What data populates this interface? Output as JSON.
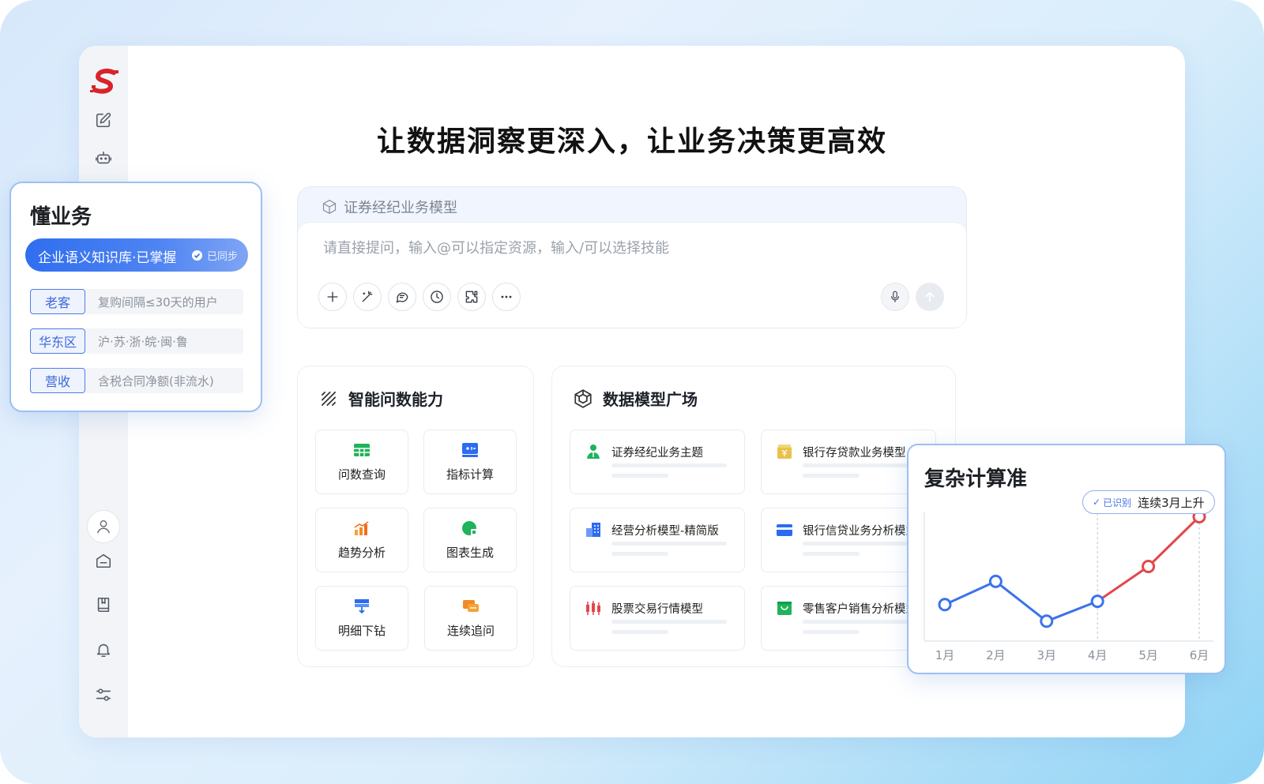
{
  "headline": "让数据洞察更深入，让业务决策更高效",
  "colors": {
    "accent": "#2f6ef0",
    "rising": "#e2474b",
    "line": "#3b73ec"
  },
  "sidebar": {
    "icons": [
      "logo-icon",
      "edit-icon",
      "robot-icon",
      "user-icon",
      "home-icon",
      "book-icon",
      "bell-icon",
      "settings-sliders-icon"
    ]
  },
  "input": {
    "model_label": "证券经纪业务模型",
    "placeholder": "请直接提问，输入@可以指定资源，输入/可以选择技能",
    "tools": [
      "plus-icon",
      "magic-wand-icon",
      "chat-icon",
      "clock-icon",
      "puzzle-icon",
      "more-icon"
    ]
  },
  "capabilities": {
    "title": "智能问数能力",
    "items": [
      {
        "label": "问数查询",
        "icon": "table-icon"
      },
      {
        "label": "指标计算",
        "icon": "calculator-icon"
      },
      {
        "label": "趋势分析",
        "icon": "bar-trend-icon"
      },
      {
        "label": "图表生成",
        "icon": "pie-icon"
      },
      {
        "label": "明细下钻",
        "icon": "drilldown-icon"
      },
      {
        "label": "连续追问",
        "icon": "followup-icon"
      }
    ]
  },
  "plaza": {
    "title": "数据模型广场",
    "models": [
      {
        "name": "证券经纪业务主题",
        "icon": "person-icon"
      },
      {
        "name": "银行存贷款业务模型",
        "icon": "yen-box-icon"
      },
      {
        "name": "经营分析模型-精简版",
        "icon": "building-icon"
      },
      {
        "name": "银行信贷业务分析模型",
        "icon": "card-icon"
      },
      {
        "name": "股票交易行情模型",
        "icon": "candlestick-icon"
      },
      {
        "name": "零售客户销售分析模型",
        "icon": "shopping-bag-icon"
      }
    ]
  },
  "biz_card": {
    "title": "懂业务",
    "kb_label": "企业语义知识库·已掌握",
    "kb_status": "已同步",
    "rows": [
      {
        "tag": "老客",
        "value": "复购间隔≤30天的用户"
      },
      {
        "tag": "华东区",
        "value": "沪·苏·浙·皖·闽·鲁"
      },
      {
        "tag": "营收",
        "value": "含税合同净额(非流水)"
      }
    ]
  },
  "calc_card": {
    "title": "复杂计算准",
    "badge_tick": "已识别",
    "badge_text": "连续3月上升"
  },
  "chart_data": {
    "type": "line",
    "title": "",
    "categories": [
      "1月",
      "2月",
      "3月",
      "4月",
      "5月",
      "6月"
    ],
    "series": [
      {
        "values": [
          2.2,
          3.6,
          1.2,
          2.4,
          4.5,
          7.5
        ]
      }
    ],
    "highlight": {
      "from_index": 3,
      "to_index": 5,
      "color": "#e2474b"
    },
    "ylim": [
      0,
      8
    ],
    "grid": "vertical dashed guides at 4月 and 6月"
  }
}
